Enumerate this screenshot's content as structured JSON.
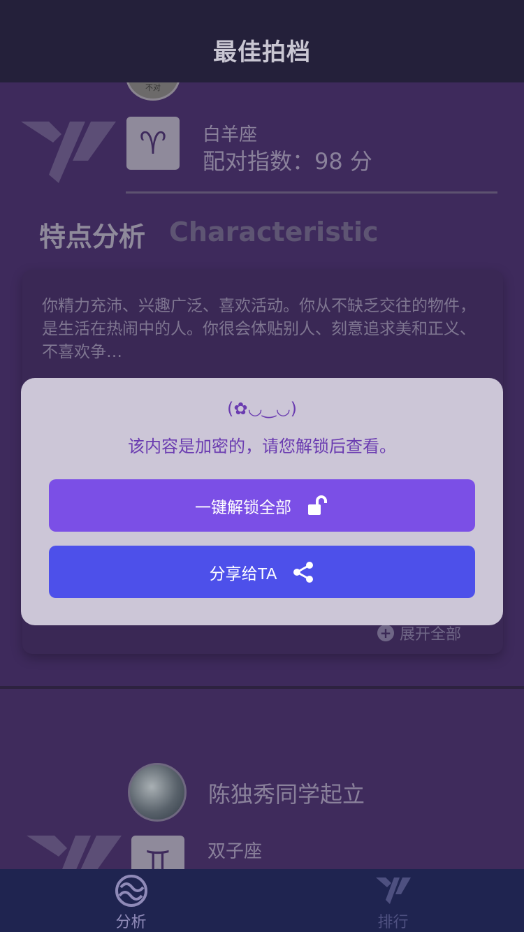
{
  "header": {
    "title": "最佳拍档"
  },
  "match1": {
    "avatar_caption": "不对",
    "sign": {
      "icon": "aries-icon",
      "glyph": "♈",
      "name": "白羊座",
      "score_text": "配对指数：98 分"
    }
  },
  "features": {
    "title": "特点分析",
    "subtitle": "Characteristic",
    "description": "你精力充沛、兴趣广泛、喜欢活动。你从不缺乏交往的物件，是生活在热闹中的人。你很会体贴别人、刻意追求美和正义、不喜欢争…",
    "expand_label": "展开全部"
  },
  "match2": {
    "name": "陈独秀同学起立",
    "sign": {
      "icon": "gemini-icon",
      "glyph": "♊",
      "name": "双子座"
    }
  },
  "modal": {
    "emoticon": "(✿◡‿◡)",
    "message": "该内容是加密的，请您解锁后查看。",
    "unlock_label": "一键解锁全部",
    "share_label": "分享给TA"
  },
  "tabbar": {
    "tabs": [
      {
        "label": "分析",
        "icon": "analysis-icon",
        "active": true
      },
      {
        "label": "排行",
        "icon": "ranking-icon",
        "active": false
      }
    ]
  },
  "colors": {
    "accent_unlock": "#7b4fe6",
    "accent_share": "#4d50ea",
    "modal_text": "#6a3bb0",
    "tabbar_bg": "#1f2450"
  }
}
